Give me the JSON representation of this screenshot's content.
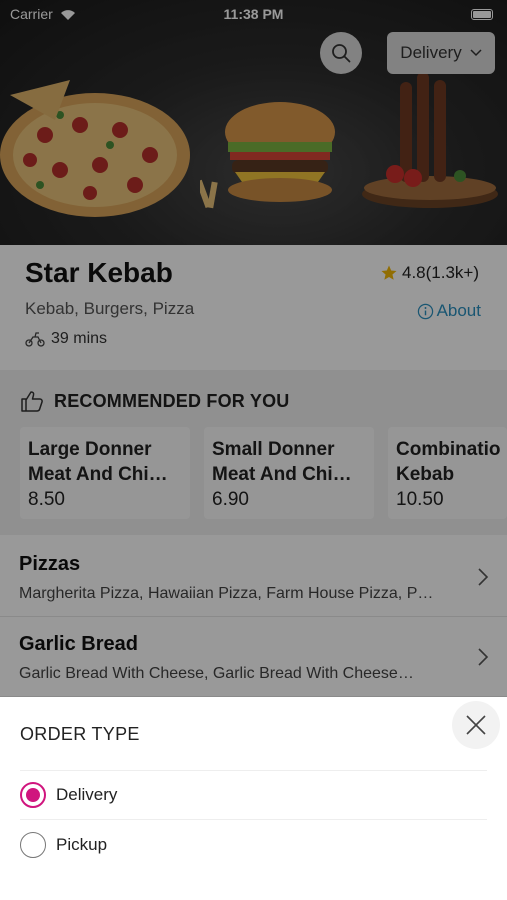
{
  "status_bar": {
    "carrier": "Carrier",
    "time": "11:38 PM"
  },
  "header": {
    "delivery_label": "Delivery"
  },
  "restaurant": {
    "name": "Star Kebab",
    "rating": "4.8(1.3k+)",
    "cuisines": "Kebab, Burgers, Pizza",
    "about_label": "About",
    "delivery_time": "39 mins"
  },
  "recommended": {
    "title": "RECOMMENDED FOR YOU",
    "items": [
      {
        "name": "Large Donner\nMeat And Chi…",
        "price": "8.50"
      },
      {
        "name": "Small Donner\nMeat And Chi…",
        "price": "6.90"
      },
      {
        "name": "Combinatio\nKebab",
        "price": "10.50"
      }
    ]
  },
  "categories": [
    {
      "title": "Pizzas",
      "items": "Margherita Pizza, Hawaiian Pizza, Farm House Pizza, P…"
    },
    {
      "title": "Garlic Bread",
      "items": "Garlic Bread With Cheese, Garlic Bread With Cheese…"
    }
  ],
  "order_type_sheet": {
    "title": "ORDER TYPE",
    "options": [
      {
        "label": "Delivery",
        "selected": true
      },
      {
        "label": "Pickup",
        "selected": false
      }
    ]
  },
  "colors": {
    "accent": "#d0157e",
    "link": "#2a8fbf",
    "star": "#f2b705"
  }
}
